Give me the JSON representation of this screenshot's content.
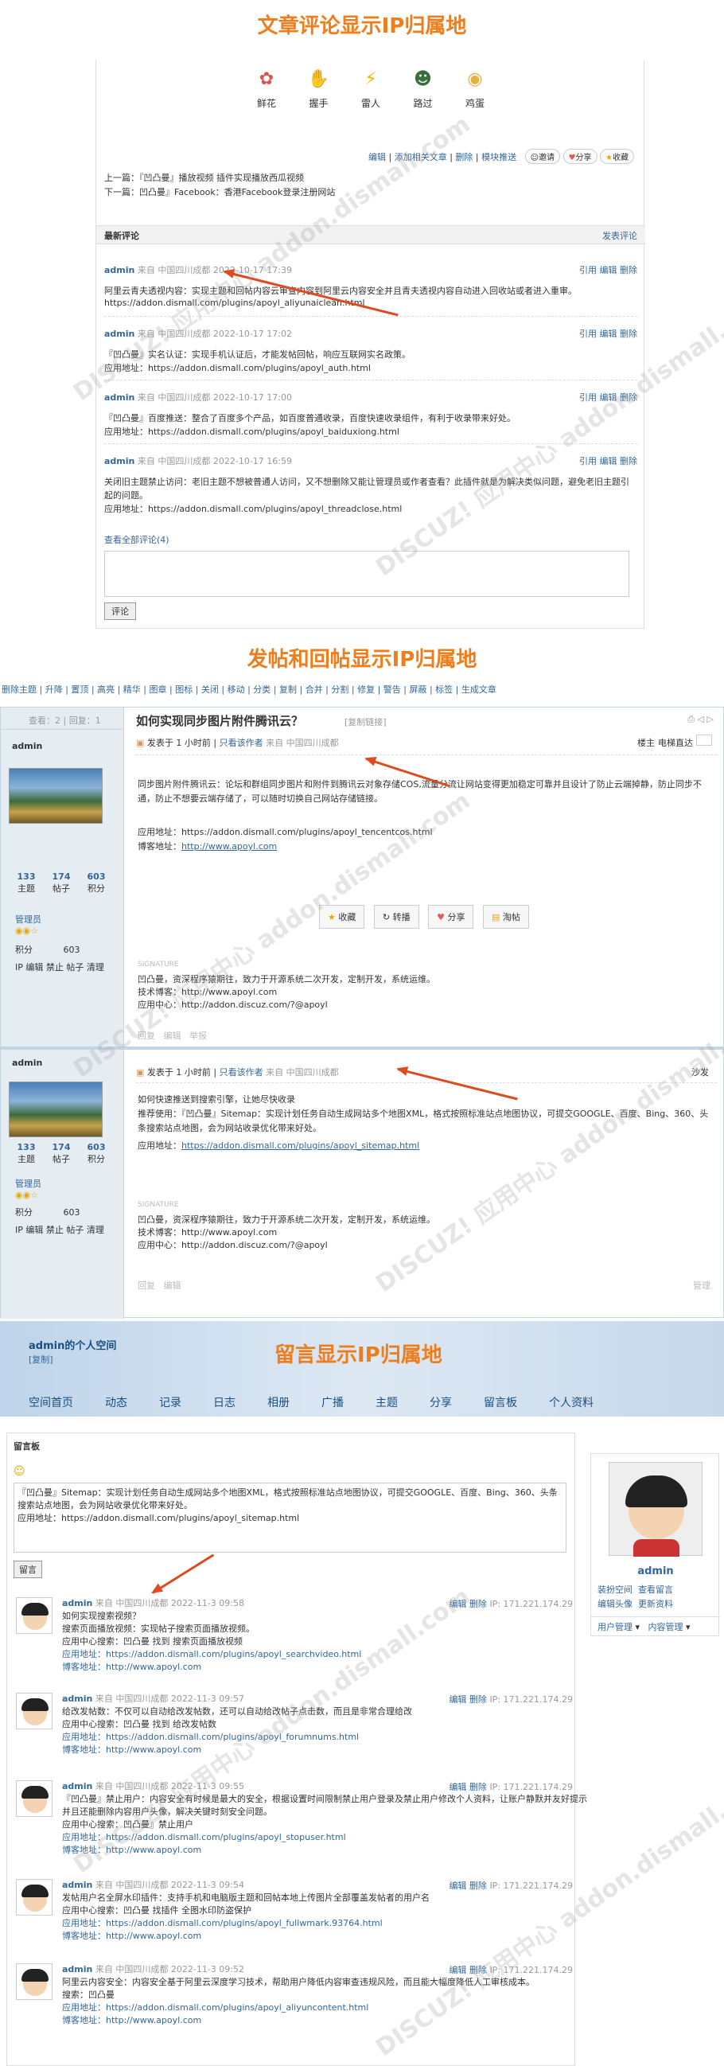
{
  "titles": {
    "s1": "文章评论显示IP归属地",
    "s2": "发帖和回帖显示IP归属地",
    "s3": "留言显示IP归属地"
  },
  "s1": {
    "reactions": [
      {
        "icon": "flower-icon",
        "label": "鲜花"
      },
      {
        "icon": "handshake-icon",
        "label": "握手"
      },
      {
        "icon": "lightning-icon",
        "label": "雷人"
      },
      {
        "icon": "pass-icon",
        "label": "路过"
      },
      {
        "icon": "egg-icon",
        "label": "鸡蛋"
      }
    ],
    "actions": [
      "编辑",
      "添加相关文章",
      "删除",
      "模块推送"
    ],
    "action_btns": [
      "邀请",
      "分享",
      "收藏"
    ],
    "prev": "上一篇：『凹凸曼』播放视频 插件实现播放西瓜视频",
    "next": "下一篇：凹凸曼』Facebook：香港Facebook登录注册网站",
    "latest": "最新评论",
    "post_comment": "发表评论",
    "comments": [
      {
        "user": "admin",
        "from": "来自 中国四川成都",
        "time": "2022-10-17 17:39",
        "ops": "引用 编辑 删除",
        "text": "阿里云青夫透视内容：实现主题和回帖内容云审查内容到阿里云内容安全并且青夫透视内容自动进入回收站或者进入重审。",
        "url": "https://addon.dismall.com/plugins/apoyl_aliyunaiclean.html"
      },
      {
        "user": "admin",
        "from": "来自 中国四川成都",
        "time": "2022-10-17 17:02",
        "ops": "引用 编辑 删除",
        "text": "『凹凸曼』实名认证：实现手机认证后，才能发帖回帖，响应互联网实名政策。",
        "url": "应用地址：https://addon.dismall.com/plugins/apoyl_auth.html"
      },
      {
        "user": "admin",
        "from": "来自 中国四川成都",
        "time": "2022-10-17 17:00",
        "ops": "引用 编辑 删除",
        "text": "『凹凸曼』百度推送：整合了百度多个产品，如百度普通收录，百度快速收录组件，有利于收录带来好处。",
        "url": "应用地址：https://addon.dismall.com/plugins/apoyl_baiduxiong.html"
      },
      {
        "user": "admin",
        "from": "来自 中国四川成都",
        "time": "2022-10-17 16:59",
        "ops": "引用 编辑 删除",
        "text": "关闭旧主题禁止访问：老旧主题不想被普通人访问，又不想删除又能让管理员或作者查看？此插件就是为解决类似问题，避免老旧主题引起的问题。",
        "url": "应用地址：https://addon.dismall.com/plugins/apoyl_threadclose.html"
      }
    ],
    "view_all": "查看全部评论(4)",
    "submit": "评论"
  },
  "s2": {
    "toolbar": "删除主题 | 升降 | 置顶 | 高亮 | 精华 | 图章 | 图标 | 关闭 | 移动 | 分类 | 复制 | 合并 | 分割 | 修复 | 警告 | 屏蔽 | 标签 | 生成文章",
    "views": "查看：2",
    "replies": "回复：1",
    "thread_title": "如何实现同步图片附件腾讯云？",
    "copy_link": "[复制链接]",
    "post1": {
      "user": "admin",
      "posted": "发表于 1 小时前",
      "only_author": "只看该作者",
      "from": "来自 中国四川成都",
      "floor": "楼主",
      "jump": "电梯直达",
      "text1": "同步图片附件腾讯云：论坛和群组同步图片和附件到腾讯云对象存储COS,流量分流让网站变得更加稳定可靠并且设计了防止云端掉静，防止同步不通，防止不想要云端存储了，可以随时切换自己网站存储链接。",
      "app": "应用地址：https://addon.dismall.com/plugins/apoyl_tencentcos.html",
      "blog_label": "博客地址：",
      "blog": "http://www.apoyl.com",
      "btns": [
        "收藏",
        "转播",
        "分享",
        "淘帖"
      ],
      "sig_title": "SIGNATURE",
      "sig": [
        "凹凸曼，资深程序猿期往，致力于开源系统二次开发，定制开发，系统运维。",
        "技术博客：http://www.apoyl.com",
        "应用中心：http://addon.discuz.com/?@apoyl"
      ],
      "foot": [
        "回复",
        "编辑",
        "举报"
      ]
    },
    "side": {
      "stats": [
        {
          "n": "133",
          "l": "主题"
        },
        {
          "n": "174",
          "l": "帖子"
        },
        {
          "n": "603",
          "l": "积分"
        }
      ],
      "role": "管理员",
      "score_label": "积分",
      "score": "603",
      "admin": "IP 编辑 禁止 帖子 清理"
    },
    "post2": {
      "user": "admin",
      "posted": "发表于 1 小时前",
      "only_author": "只看该作者",
      "from": "来自 中国四川成都",
      "floor": "沙发",
      "text1": "如何快速推送到搜索引擎，让她尽快收录",
      "text2": "推荐使用：『凹凸曼』Sitemap：实现计划任务自动生成网站多个地图XML，格式按照标准站点地图协议，可提交GOOGLE、百度、Bing、360、头条搜索站点地图，会为网站收录优化带来好处。",
      "app_label": "应用地址：",
      "app": "https://addon.dismall.com/plugins/apoyl_sitemap.html",
      "foot": [
        "回复",
        "编辑"
      ],
      "manage": "管理"
    }
  },
  "s3": {
    "space_title": "admin的个人空间",
    "copy": "[复制]",
    "nav": [
      "空间首页",
      "动态",
      "记录",
      "日志",
      "相册",
      "广播",
      "主题",
      "分享",
      "留言板",
      "个人资料"
    ],
    "board": "留言板",
    "input_text": "『凹凸曼』Sitemap：实现计划任务自动生成网站多个地图XML，格式按照标准站点地图协议，可提交GOOGLE、百度、Bing、360、头条搜索站点地图，会为网站收录优化带来好处。\n应用地址：https://addon.dismall.com/plugins/apoyl_sitemap.html",
    "submit": "留言",
    "profile": {
      "name": "admin",
      "links": [
        "装扮空间",
        "查看留言",
        "编辑头像",
        "更新资料"
      ],
      "menus": [
        "用户管理",
        "内容管理"
      ]
    },
    "messages": [
      {
        "user": "admin",
        "from": "来自 中国四川成都",
        "time": "2022-11-3 09:58",
        "ops": "编辑 删除",
        "ip": "IP: 171.221.174.29",
        "lines": [
          "如何实现搜索视频？",
          "搜索页面播放视频：实现帖子搜索页面播放视频。",
          "应用中心搜索：凹凸曼  找到  搜索页面播放视频",
          "应用地址：https://addon.dismall.com/plugins/apoyl_searchvideo.html",
          "博客地址：http://www.apoyl.com"
        ]
      },
      {
        "user": "admin",
        "from": "来自 中国四川成都",
        "time": "2022-11-3 09:57",
        "ops": "编辑 删除",
        "ip": "IP: 171.221.174.29",
        "lines": [
          "给改发帖数：不仅可以自动给改发帖数，还可以自动给改帖子点击数，而且是非常合理给改",
          "应用中心搜索：凹凸曼  找到  给改发帖数",
          "应用地址：https://addon.dismall.com/plugins/apoyl_forumnums.html",
          "博客地址：http://www.apoyl.com"
        ]
      },
      {
        "user": "admin",
        "from": "来自 中国四川成都",
        "time": "2022-11-3 09:55",
        "ops": "编辑 删除",
        "ip": "IP: 171.221.174.29",
        "lines": [
          "『凹凸曼』禁止用户：内容安全有时候是最大的安全，根据设置时间限制禁止用户登录及禁止用户修改个人资料，让账户静默并友好提示并且还能删除内容用户头像，解决关键时刻安全问题。",
          "应用中心搜索：凹凸曼』禁止用户",
          "应用地址：https://addon.dismall.com/plugins/apoyl_stopuser.html",
          "博客地址：http://www.apoyl.com"
        ]
      },
      {
        "user": "admin",
        "from": "来自 中国四川成都",
        "time": "2022-11-3 09:54",
        "ops": "编辑 删除",
        "ip": "IP: 171.221.174.29",
        "lines": [
          "发帖用户名全屏水印插件：支持手机和电脑版主题和回帖本地上传图片全部覆盖发帖者的用户名",
          "应用中心搜索：凹凸曼  找插件  全图水印防盗保护",
          "应用地址：https://addon.dismall.com/plugins/apoyl_fullwmark.93764.html",
          "博客地址：http://www.apoyl.com"
        ]
      },
      {
        "user": "admin",
        "from": "来自 中国四川成都",
        "time": "2022-11-3 09:52",
        "ops": "编辑 删除",
        "ip": "IP: 171.221.174.29",
        "lines": [
          "阿里云内容安全：内容安全基于阿里云深度学习技术，帮助用户降低内容审查违规风险，而且能大幅度降低人工审核成本。",
          "搜索：凹凸曼",
          "应用地址：https://addon.dismall.com/plugins/apoyl_aliyuncontent.html",
          "博客地址：http://www.apoyl.com"
        ]
      }
    ]
  },
  "watermark": "DISCUZ! 应用中心 addon.dismall.com"
}
